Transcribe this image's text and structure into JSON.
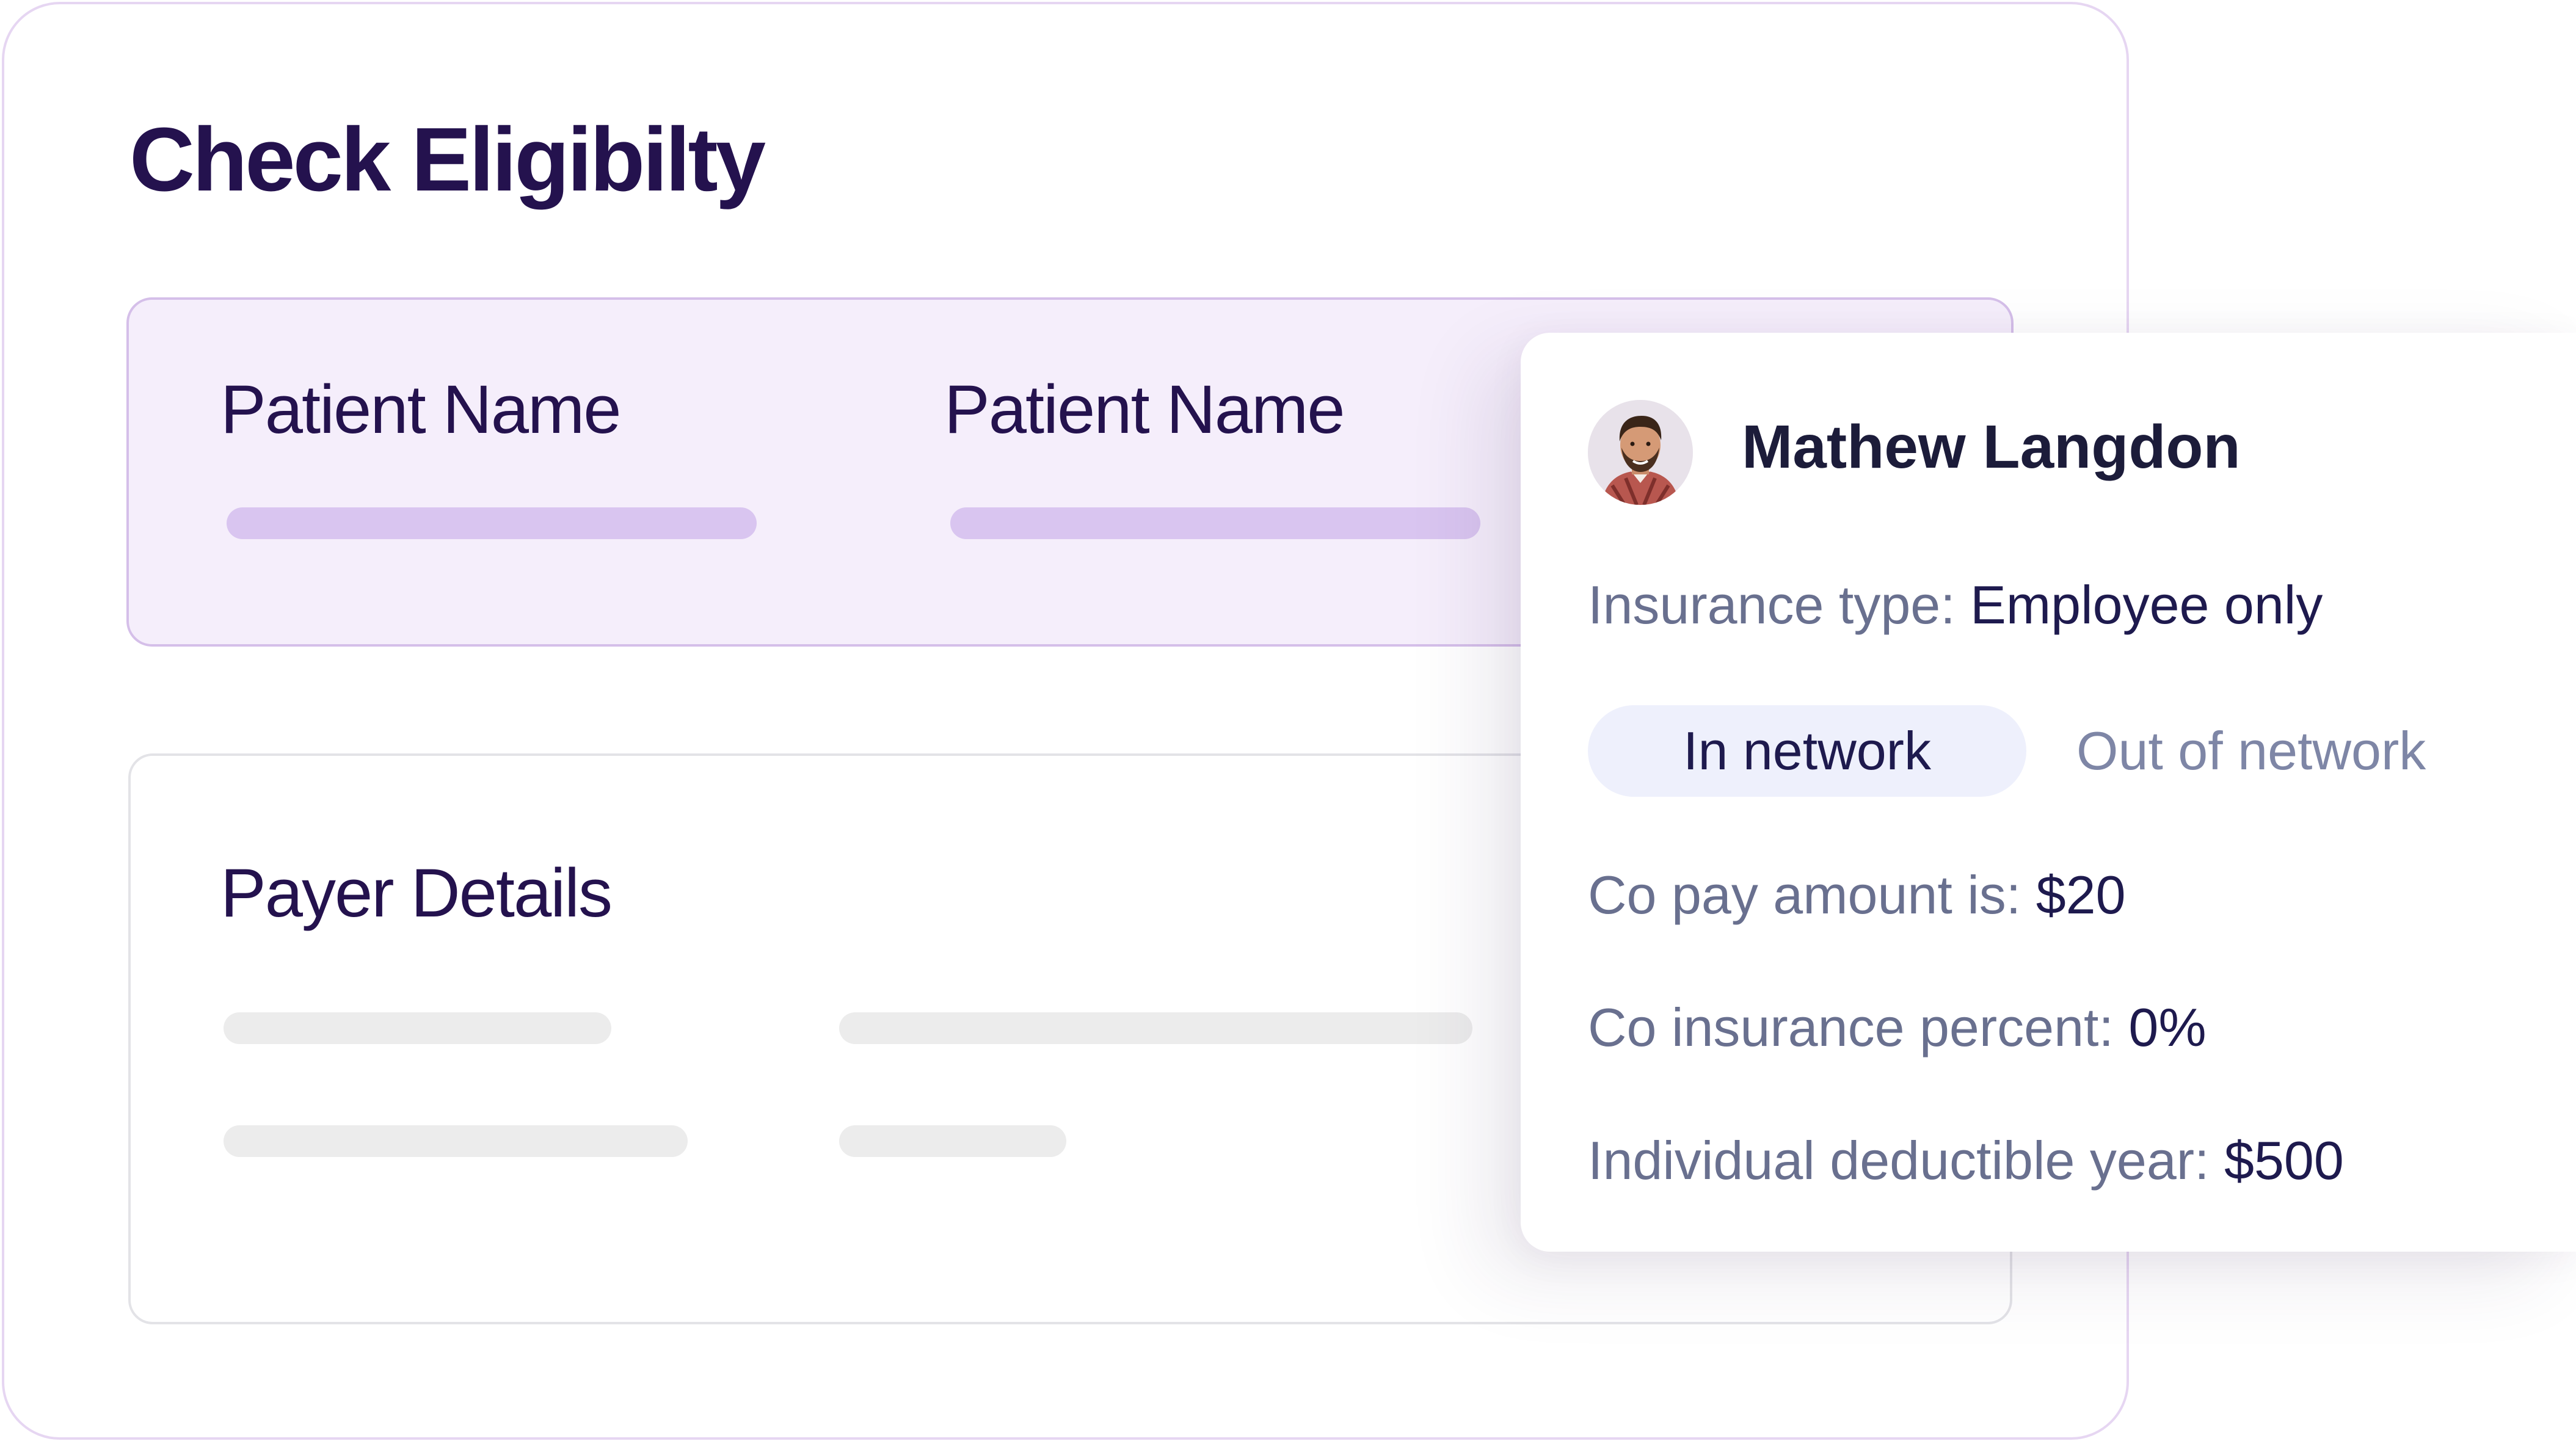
{
  "title": "Check Eligibilty",
  "patient_section": {
    "fields": [
      {
        "label": "Patient Name"
      },
      {
        "label": "Patient Name"
      }
    ]
  },
  "payer_section": {
    "title": "Payer Details"
  },
  "popup": {
    "avatar_icon": "person-photo",
    "name": "Mathew Langdon",
    "insurance_type_label": "Insurance type:",
    "insurance_type_value": "Employee only",
    "tabs": [
      {
        "label": "In network",
        "active": true
      },
      {
        "label": "Out of network",
        "active": false
      }
    ],
    "copay_label": "Co pay amount is:",
    "copay_value": "$20",
    "coinsurance_label": "Co insurance percent:",
    "coinsurance_value": "0%",
    "deductible_label": "Individual deductible year:",
    "deductible_value": "$500"
  },
  "colors": {
    "title": "#24124e",
    "panel_bg": "#f5eefb",
    "placeholder_purple": "#d9c5f0",
    "placeholder_grey": "#ececec",
    "label_grey": "#69708f",
    "value_navy": "#1e1a4e",
    "tab_active_bg": "#eef0fc"
  }
}
